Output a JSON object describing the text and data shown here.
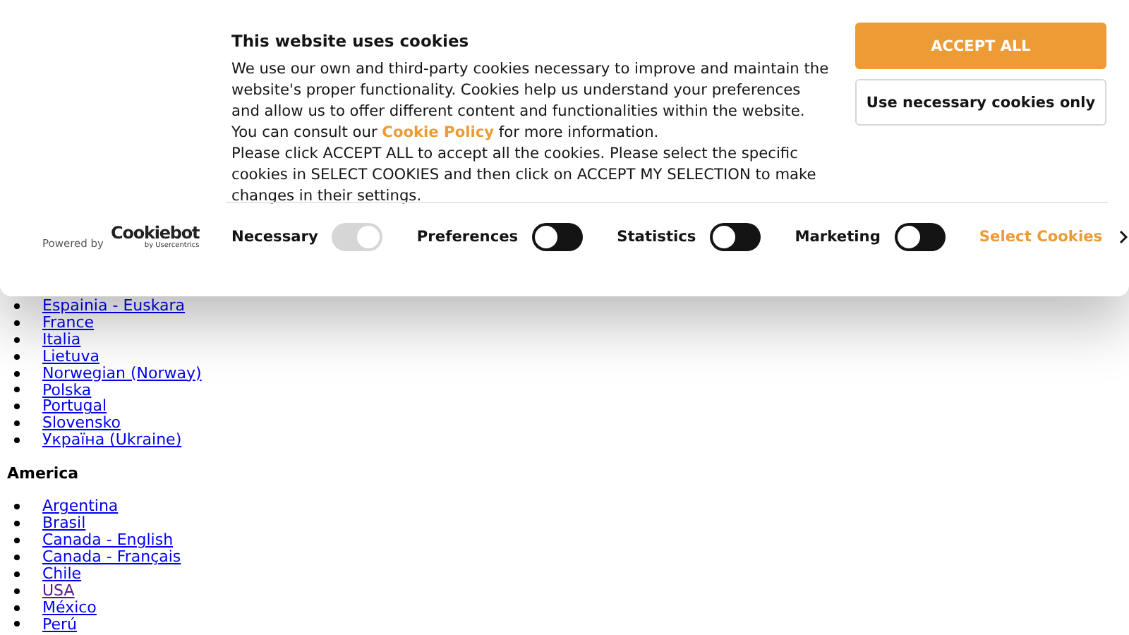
{
  "cookie_banner": {
    "title": "This website uses cookies",
    "paragraphs": [
      "We use our own and third-party cookies necessary to improve and maintain the website's proper functionality. Cookies help us understand your preferences and allow us to offer different content and functionalities within the website. You can consult our **Cookie Policy** for more information.",
      "Please click ACCEPT ALL to accept all the cookies. Please select the specific cookies in SELECT COOKIES and then click on ACCEPT MY SELECTION to make changes in their settings."
    ],
    "buttons": [
      {
        "label": "ACCEPT ALL",
        "kind": "primary"
      },
      {
        "label": "Use necessary cookies only",
        "kind": "secondary"
      }
    ],
    "logo": {
      "powered_by": "Powered by",
      "name": "Cookiebot",
      "byline": "by Usercentrics"
    },
    "toggles": [
      {
        "label": "Necessary",
        "checked": true,
        "disabled": true
      },
      {
        "label": "Preferences",
        "checked": false,
        "disabled": false
      },
      {
        "label": "Statistics",
        "checked": false,
        "disabled": false
      },
      {
        "label": "Marketing",
        "checked": false,
        "disabled": false
      }
    ],
    "select_link": "Select Cookies"
  },
  "page": {
    "sections": [
      {
        "links": [
          {
            "label": "Espainia - Euskara",
            "visited": false
          },
          {
            "label": "France",
            "visited": false
          },
          {
            "label": "Italia",
            "visited": false
          },
          {
            "label": "Lietuva",
            "visited": false
          },
          {
            "label": "Norwegian (Norway)",
            "visited": false
          },
          {
            "label": "Polska",
            "visited": false
          },
          {
            "label": "Portugal",
            "visited": false
          },
          {
            "label": "Slovensko",
            "visited": false
          },
          {
            "label": "Україна (Ukraine)",
            "visited": false
          }
        ]
      },
      {
        "heading": "America",
        "links": [
          {
            "label": "Argentina",
            "visited": false
          },
          {
            "label": "Brasil",
            "visited": false
          },
          {
            "label": "Canada - English",
            "visited": false
          },
          {
            "label": "Canada - Français",
            "visited": false
          },
          {
            "label": "Chile",
            "visited": false
          },
          {
            "label": "USA",
            "visited": true
          },
          {
            "label": "México",
            "visited": false
          },
          {
            "label": "Perú",
            "visited": false
          }
        ]
      }
    ]
  }
}
